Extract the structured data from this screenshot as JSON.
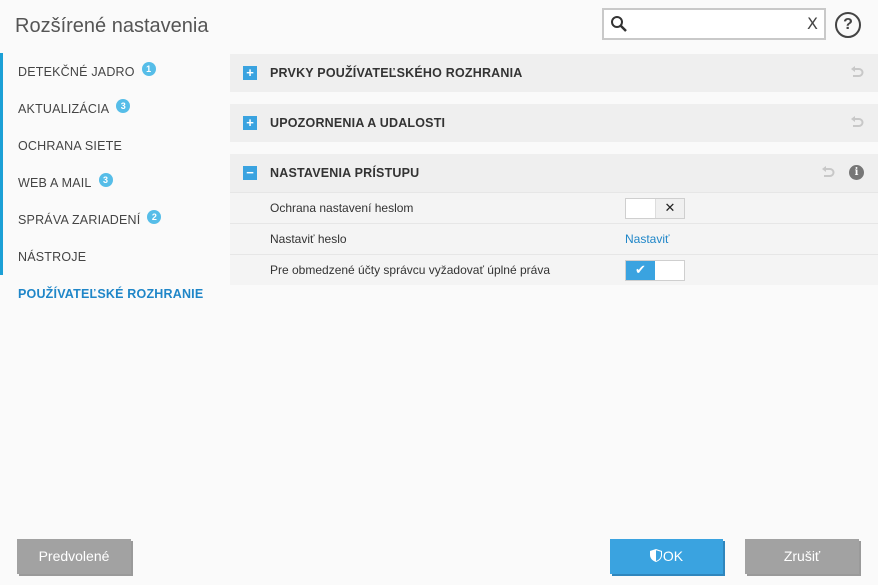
{
  "header": {
    "title": "Rozšírené nastavenia",
    "search_value": "",
    "clear_glyph": "X",
    "help_glyph": "?"
  },
  "sidebar": {
    "items": [
      {
        "label": "DETEKČNÉ JADRO",
        "badge": "1"
      },
      {
        "label": "AKTUALIZÁCIA",
        "badge": "3"
      },
      {
        "label": "OCHRANA SIETE",
        "badge": ""
      },
      {
        "label": "WEB A MAIL",
        "badge": "3"
      },
      {
        "label": "SPRÁVA ZARIADENÍ",
        "badge": "2"
      },
      {
        "label": "NÁSTROJE",
        "badge": ""
      },
      {
        "label": "POUŽÍVATEĽSKÉ ROZHRANIE",
        "badge": ""
      }
    ]
  },
  "sections": [
    {
      "title": "PRVKY POUŽÍVATEĽSKÉHO ROZHRANIA",
      "expander": "+"
    },
    {
      "title": "UPOZORNENIA A UDALOSTI",
      "expander": "+"
    },
    {
      "title": "NASTAVENIA PRÍSTUPU",
      "expander": "−",
      "info_glyph": "i"
    }
  ],
  "access_settings": {
    "rows": [
      {
        "label": "Ochrana nastavení heslom",
        "toggle_glyph": "✕",
        "state": "off"
      },
      {
        "label": "Nastaviť heslo",
        "link": "Nastaviť"
      },
      {
        "label": "Pre obmedzené účty správcu vyžadovať úplné práva",
        "toggle_glyph": "✔",
        "state": "on"
      }
    ]
  },
  "footer": {
    "default_label": "Predvolené",
    "ok_label": "OK",
    "cancel_label": "Zrušiť"
  },
  "colors": {
    "accent": "#3aa3e0",
    "link": "#1f86c8",
    "badge": "#56bde8",
    "button_gray": "#a2a2a2"
  }
}
